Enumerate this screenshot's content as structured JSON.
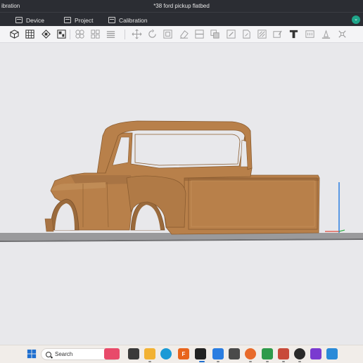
{
  "window": {
    "left_title": "ibration",
    "document_title": "*38 ford pickup flatbed"
  },
  "menu": {
    "items": [
      {
        "label": "Device",
        "icon": "device-icon"
      },
      {
        "label": "Project",
        "icon": "project-icon"
      },
      {
        "label": "Calibration",
        "icon": "calibration-icon"
      }
    ],
    "toggle_icon": "chevron-down-icon"
  },
  "toolbar": {
    "icons": [
      "add-cube-icon",
      "grid-icon",
      "auto-orient-icon",
      "arrange-icon",
      "split-objects-icon",
      "split-parts-icon",
      "layers-icon",
      "move-icon",
      "rotate-icon",
      "scale-icon",
      "erase-icon",
      "cut-icon",
      "boolean-icon",
      "support-paint-icon",
      "seam-paint-icon",
      "color-paint-icon",
      "text-icon",
      "assembly-icon",
      "measure-icon"
    ]
  },
  "colors": {
    "model": "#b8804a",
    "bed": "#9a9a9c",
    "accent": "#1fa58a",
    "z_axis": "#2a7de1"
  },
  "taskbar": {
    "search_placeholder": "Search",
    "apps": [
      "windows-start-icon",
      "widgets-icon",
      "file-explorer-icon",
      "edge-icon",
      "app-f-icon",
      "terminal-icon",
      "slicer-icon",
      "calculator-icon",
      "firefox-icon",
      "chrome-icon",
      "evernote-icon",
      "creality-icon",
      "media-player-icon",
      "clipchamp-icon",
      "store-icon"
    ]
  }
}
